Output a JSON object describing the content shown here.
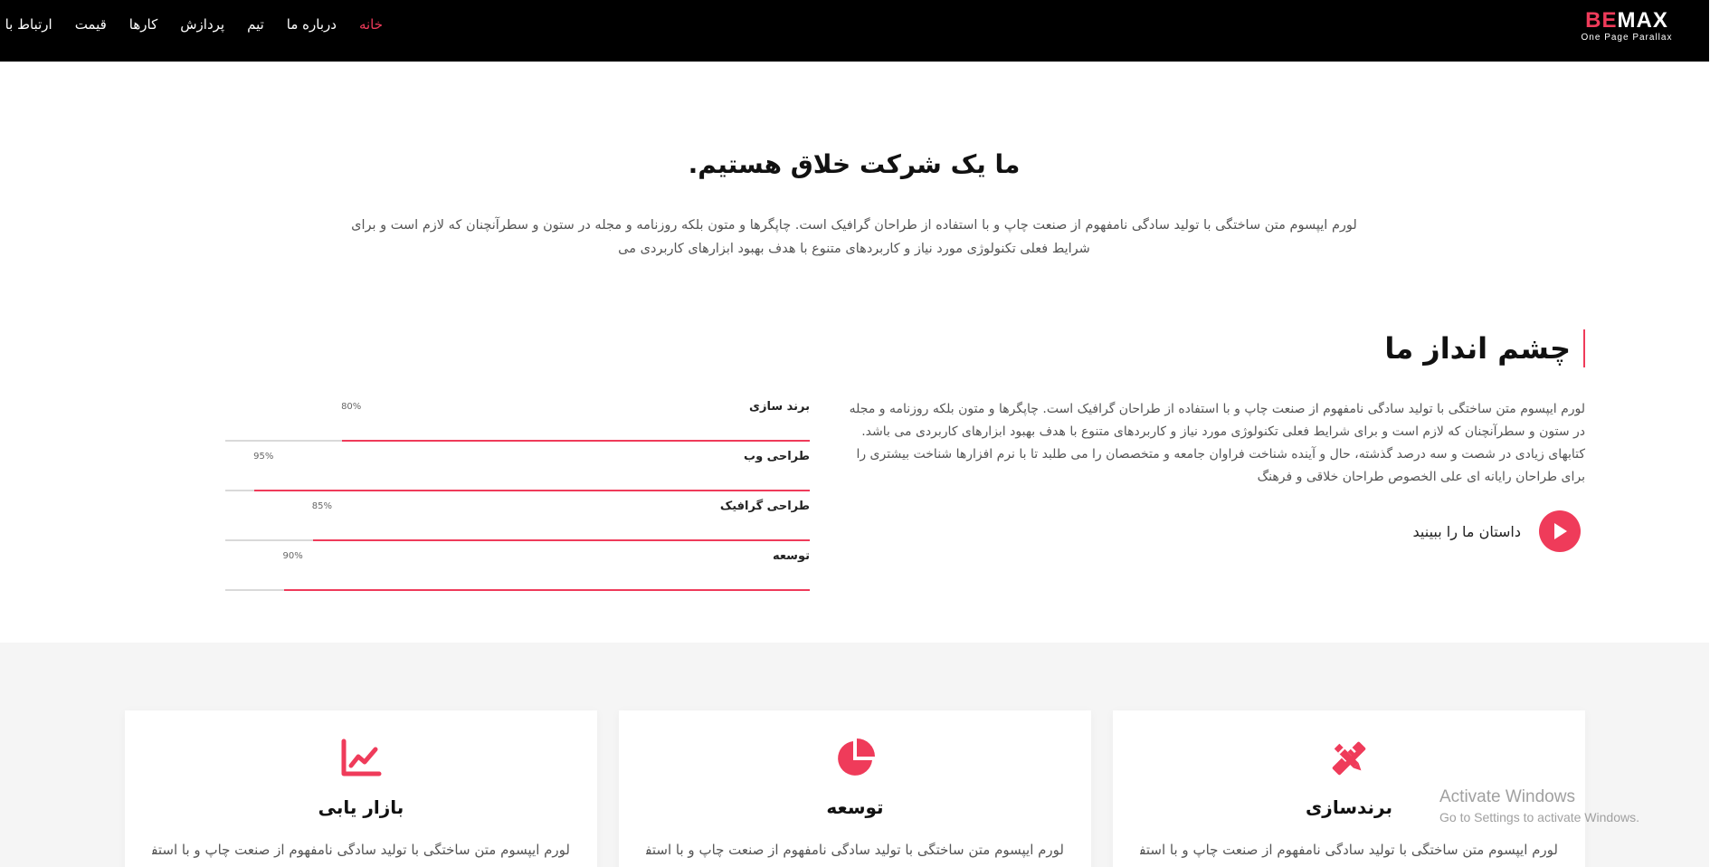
{
  "brand": {
    "word_a": "BE",
    "word_b": "MAX",
    "tagline": "One Page Parallax",
    "accent": "#ef3b5a"
  },
  "nav": {
    "items": [
      {
        "label": "خانه",
        "active": true
      },
      {
        "label": "درباره ما",
        "active": false
      },
      {
        "label": "تیم",
        "active": false
      },
      {
        "label": "پردازش",
        "active": false
      },
      {
        "label": "کارها",
        "active": false
      },
      {
        "label": "قیمت",
        "active": false
      },
      {
        "label": "ارتباط با ما",
        "active": false
      }
    ]
  },
  "intro": {
    "title": "ما یک شرکت خلاق هستیم.",
    "text": "لورم ایپسوم متن ساختگی با تولید سادگی نامفهوم از صنعت چاپ و با استفاده از طراحان گرافیک است. چاپگرها و متون بلکه روزنامه و مجله در ستون و سطرآنچنان که لازم است و برای شرایط فعلی تکنولوژی مورد نیاز و کاربردهای متنوع با هدف بهبود ابزارهای کاربردی می"
  },
  "vision": {
    "title": "چشم انداز ما",
    "text": "لورم ایپسوم متن ساختگی با تولید سادگی نامفهوم از صنعت چاپ و با استفاده از طراحان گرافیک است. چاپگرها و متون بلکه روزنامه و مجله در ستون و سطرآنچنان که لازم است و برای شرایط فعلی تکنولوژی مورد نیاز و کاربردهای متنوع با هدف بهبود ابزارهای کاربردی می باشد. کتابهای زیادی در شصت و سه درصد گذشته، حال و آینده شناخت فراوان جامعه و متخصصان را می طلبد تا با نرم افزارها شناخت بیشتری را برای طراحان رایانه ای علی الخصوص طراحان خلاقی و فرهنگ",
    "story_label": "داستان ما را ببینید",
    "play_icon": "play-icon"
  },
  "skills": [
    {
      "label": "برند سازی",
      "percent": 80,
      "percent_text": "80%"
    },
    {
      "label": "طراحی وب",
      "percent": 95,
      "percent_text": "95%"
    },
    {
      "label": "طراحی گرافیک",
      "percent": 85,
      "percent_text": "85%"
    },
    {
      "label": "توسعه",
      "percent": 90,
      "percent_text": "90%"
    }
  ],
  "services": [
    {
      "icon": "pen-ruler-icon",
      "title": "برندسازی",
      "text": "لورم ایپسوم متن ساختگی با تولید سادگی نامفهوم از صنعت چاپ و با استفاده از"
    },
    {
      "icon": "pie-chart-icon",
      "title": "توسعه",
      "text": "لورم ایپسوم متن ساختگی با تولید سادگی نامفهوم از صنعت چاپ و با استفاده از"
    },
    {
      "icon": "line-chart-icon",
      "title": "بازار یابی",
      "text": "لورم ایپسوم متن ساختگی با تولید سادگی نامفهوم از صنعت چاپ و با استفاده از"
    }
  ],
  "watermark": {
    "title": "Activate Windows",
    "subtitle": "Go to Settings to activate Windows."
  }
}
